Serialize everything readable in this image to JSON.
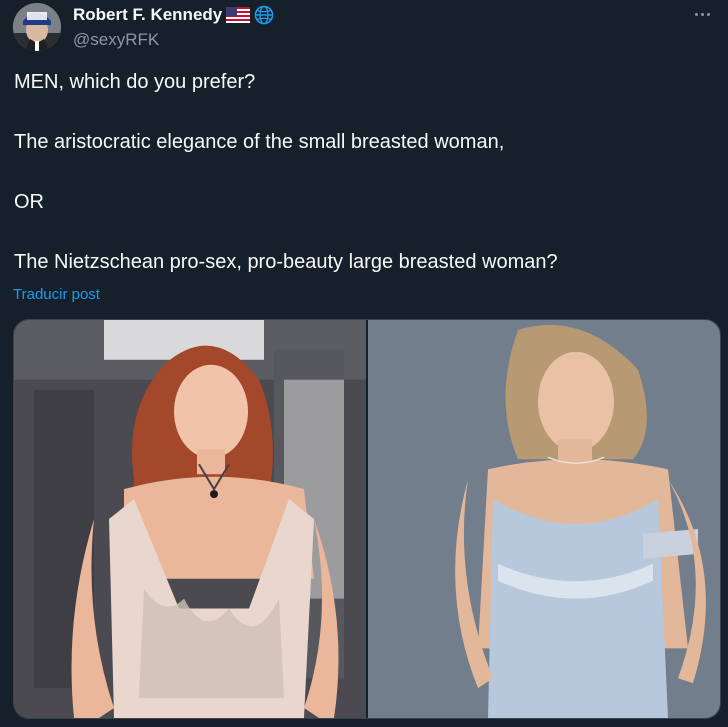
{
  "author": {
    "display_name": "Robert F. Kennedy",
    "handle": "@sexyRFK",
    "avatar_icon": "avatar-photo",
    "badges": [
      "us-flag-icon",
      "globe-icon"
    ]
  },
  "tweet": {
    "lines": [
      "MEN, which do you prefer?",
      "The aristocratic elegance of the small breasted woman,",
      "OR",
      "The Nietzschean pro-sex, pro-beauty large breasted woman?"
    ],
    "translate_label": "Traducir post"
  },
  "media": {
    "photos": [
      "photo-woman-red-hair-white-dress",
      "photo-woman-blonde-blue-dress"
    ]
  },
  "colors": {
    "background": "#15202b",
    "primary_text": "#f7f9f9",
    "secondary_text": "#8b98a5",
    "link": "#1d9bf0",
    "border": "#38444d"
  }
}
